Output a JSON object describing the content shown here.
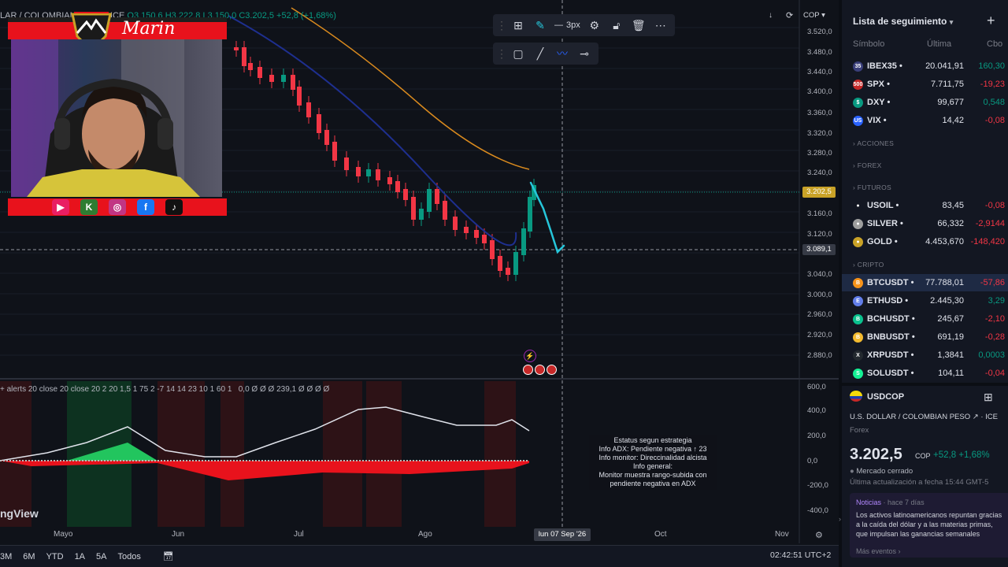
{
  "chart": {
    "symbol_header": "LAR / COLOMBIAN PESO · ICE",
    "ohlc_o": "O",
    "ohlc_open": "3.150,6",
    "ohlc_h": "H",
    "ohlc_high": "3.222,8",
    "ohlc_l": "L",
    "ohlc_low": "3.150,0",
    "ohlc_c": "C",
    "ohlc_close": "3.202,5 +52,8 (+1,68%)",
    "currency": "COP",
    "price_axis": [
      "3.520,0",
      "3.480,0",
      "3.440,0",
      "3.400,0",
      "3.360,0",
      "3.320,0",
      "3.280,0",
      "3.240,0",
      "3.160,0",
      "3.120,0",
      "3.040,0",
      "3.000,0",
      "2.960,0",
      "2.920,0",
      "2.880,0"
    ],
    "last_price_tag": "3.202,5",
    "cursor_price_tag": "3.089,1",
    "line_width_label": "3px",
    "time_axis": [
      "Mayo",
      "Jun",
      "Jul",
      "Ago",
      "Oct",
      "Nov"
    ],
    "time_cursor": "lun 07 Sep '26",
    "indicator_legend": "+ alerts 20 close 20 close 20 2 20 1,5 1 75 2 -7 14 14 23 10 1 60 1",
    "indicator_values": "0,0  Ø Ø Ø 239,1 Ø Ø Ø Ø",
    "indicator_axis": [
      "600,0",
      "400,0",
      "200,0",
      "0,0",
      "-200,0",
      "-400,0"
    ],
    "info_box": [
      "Estatus segun estrategia",
      "Info ADX: Pendiente negativa ↑ 23",
      "Info monitor: Direccinalidad alcista",
      "Info general:",
      "Monitor muestra rango-subida con",
      "pendiente negativa en ADX"
    ],
    "tv_logo": "ngView",
    "ranges": [
      "3M",
      "6M",
      "YTD",
      "1A",
      "5A",
      "Todos"
    ],
    "clock": "02:42:51 UTC+2",
    "colors": {
      "up": "#089981",
      "down": "#f23645",
      "ma_fast": "#1e2f8f",
      "ma_slow": "#d98a1e",
      "drawing": "#26c6da"
    }
  },
  "overlay": {
    "streamer_name": "Marin"
  },
  "watchlist": {
    "title": "Lista de seguimiento",
    "col_symbol": "Símbolo",
    "col_last": "Última",
    "col_change": "Cbo",
    "rows_top": [
      {
        "icon": "35",
        "icon_color": "#3a3f7a",
        "symbol": "IBEX35",
        "last": "20.041,91",
        "change": "160,30",
        "dir": "pos"
      },
      {
        "icon": "500",
        "icon_color": "#c62828",
        "symbol": "SPX",
        "last": "7.711,75",
        "change": "-19,23",
        "dir": "neg"
      },
      {
        "icon": "$",
        "icon_color": "#089981",
        "symbol": "DXY",
        "last": "99,677",
        "change": "0,548",
        "dir": "pos"
      },
      {
        "icon": "US",
        "icon_color": "#2962ff",
        "symbol": "VIX",
        "last": "14,42",
        "change": "-0,08",
        "dir": "neg"
      }
    ],
    "sec_acciones": "ACCIONES",
    "sec_forex": "FOREX",
    "sec_futuros": "FUTUROS",
    "rows_fut": [
      {
        "icon": "●",
        "icon_color": "#131722",
        "symbol": "USOIL",
        "last": "83,45",
        "change": "-0,08",
        "dir": "neg"
      },
      {
        "icon": "●",
        "icon_color": "#9e9e9e",
        "symbol": "SILVER",
        "last": "66,332",
        "change": "-2,9144",
        "dir": "neg"
      },
      {
        "icon": "●",
        "icon_color": "#c9a227",
        "symbol": "GOLD",
        "last": "4.453,670",
        "change": "-148,420",
        "dir": "neg"
      }
    ],
    "sec_cripto": "CRIPTO",
    "rows_crypto": [
      {
        "icon": "B",
        "icon_color": "#f7931a",
        "symbol": "BTCUSDT",
        "last": "77.788,01",
        "change": "-57,86",
        "dir": "neg"
      },
      {
        "icon": "E",
        "icon_color": "#627eea",
        "symbol": "ETHUSD",
        "last": "2.445,30",
        "change": "3,29",
        "dir": "pos"
      },
      {
        "icon": "B",
        "icon_color": "#0ac18e",
        "symbol": "BCHUSDT",
        "last": "245,67",
        "change": "-2,10",
        "dir": "neg"
      },
      {
        "icon": "B",
        "icon_color": "#f3ba2f",
        "symbol": "BNBUSDT",
        "last": "691,19",
        "change": "-0,28",
        "dir": "neg"
      },
      {
        "icon": "X",
        "icon_color": "#23292f",
        "symbol": "XRPUSDT",
        "last": "1,3841",
        "change": "0,0003",
        "dir": "pos"
      },
      {
        "icon": "S",
        "icon_color": "#14f195",
        "symbol": "SOLUSDT",
        "last": "104,11",
        "change": "-0,04",
        "dir": "neg"
      }
    ]
  },
  "detail": {
    "symbol": "USDCOP",
    "name": "U.S. DOLLAR / COLOMBIAN PESO ↗ · ICE",
    "market_type": "Forex",
    "price": "3.202,5",
    "currency": "COP",
    "change": "+52,8",
    "change_pct": "+1,68%",
    "status": "Mercado cerrado",
    "updated": "Última actualización a fecha 15:44 GMT-5",
    "news_label": "Noticias",
    "news_time": "· hace 7 días",
    "news_text": "Los activos latinoamericanos repuntan gracias a la caída del dólar y a las materias primas, que impulsan las ganancias semanales",
    "more_events": "Más eventos ›"
  }
}
